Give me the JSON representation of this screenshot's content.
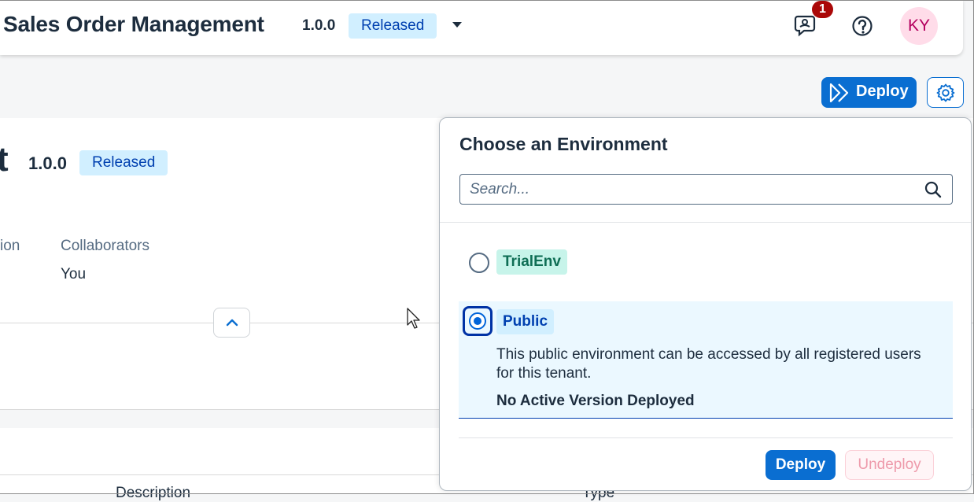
{
  "shell": {
    "title": "Sales Order Management",
    "version": "1.0.0",
    "status": "Released",
    "notification_count": "1",
    "avatar_initials": "KY",
    "icons": [
      "chevron-down-icon",
      "notification-icon",
      "help-icon"
    ]
  },
  "toolbar": {
    "deploy_label": "Deploy",
    "icons": [
      "deploy-icon",
      "settings-icon"
    ]
  },
  "object_page": {
    "title_fragment": "t",
    "version": "1.0.0",
    "status": "Released",
    "attr1_label_fragment": "ion",
    "attr2_label": "Collaborators",
    "attr2_value": "You",
    "col_description": "Description",
    "col_type": "Type"
  },
  "popover": {
    "title": "Choose an Environment",
    "search_placeholder": "Search...",
    "environments": [
      {
        "name": "TrialEnv",
        "selected": false
      },
      {
        "name": "Public",
        "selected": true,
        "description": "This public environment can be accessed by all registered users for this tenant.",
        "status": "No Active Version Deployed"
      }
    ],
    "deploy_label": "Deploy",
    "undeploy_label": "Undeploy"
  },
  "colors": {
    "accent": "#0a6ed1",
    "released_bg": "#d1efff",
    "trial_bg": "#c7f4ea",
    "notification": "#aa0808"
  }
}
